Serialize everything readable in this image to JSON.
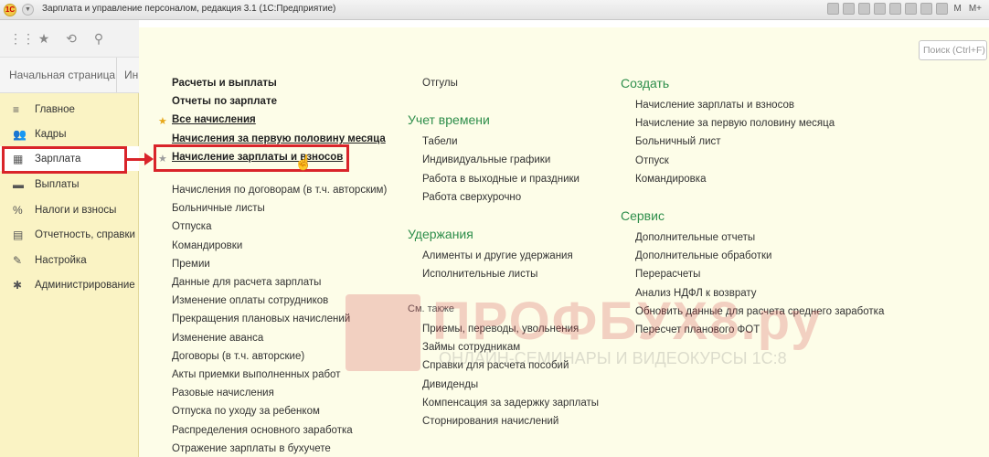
{
  "window": {
    "title": "Зарплата и управление персоналом, редакция 3.1  (1С:Предприятие)",
    "logo_text": "1С",
    "right_labels": [
      "M",
      "M+"
    ]
  },
  "tabs": {
    "home": "Начальная страница",
    "next_fragment": "Ин"
  },
  "sidebar": {
    "items": [
      {
        "label": "Главное",
        "icon": "list-icon",
        "glyph": "≡"
      },
      {
        "label": "Кадры",
        "icon": "people-icon",
        "glyph": "👥"
      },
      {
        "label": "Зарплата",
        "icon": "calculator-icon",
        "glyph": "▦"
      },
      {
        "label": "Выплаты",
        "icon": "payments-icon",
        "glyph": "▬"
      },
      {
        "label": "Налоги и взносы",
        "icon": "percent-icon",
        "glyph": "%"
      },
      {
        "label": "Отчетность, справки",
        "icon": "reports-icon",
        "glyph": "▤"
      },
      {
        "label": "Настройка",
        "icon": "wrench-icon",
        "glyph": "✎"
      },
      {
        "label": "Администрирование",
        "icon": "gear-icon",
        "glyph": "✱"
      }
    ],
    "active_index": 2
  },
  "search": {
    "placeholder": "Поиск (Ctrl+F)"
  },
  "col1": {
    "bold_links": [
      "Расчеты и выплаты",
      "Отчеты по зарплате",
      "Все начисления",
      "Начисления за первую половину месяца",
      "Начисление зарплаты и взносов"
    ],
    "links": [
      "Начисления по договорам (в т.ч. авторским)",
      "Больничные листы",
      "Отпуска",
      "Командировки",
      "Премии",
      "Данные для расчета зарплаты",
      "Изменение оплаты сотрудников",
      "Прекращения плановых начислений",
      "Изменение аванса",
      "Договоры (в т.ч. авторские)",
      "Акты приемки выполненных работ",
      "Разовые начисления",
      "Отпуска по уходу за ребенком",
      "Распределения основного заработка",
      "Отражение зарплаты в бухучете"
    ]
  },
  "col2": {
    "top_link": "Отгулы",
    "time_section": "Учет времени",
    "time_links": [
      "Табели",
      "Индивидуальные графики",
      "Работа в выходные и праздники",
      "Работа сверхурочно"
    ],
    "deductions_section": "Удержания",
    "deductions_links": [
      "Алименты и другие удержания",
      "Исполнительные листы"
    ],
    "see_also": "См. также",
    "see_also_links": [
      "Приемы, переводы, увольнения",
      "Займы сотрудникам",
      "Справки для расчета пособий",
      "Дивиденды",
      "Компенсация за задержку зарплаты",
      "Сторнирования начислений"
    ]
  },
  "col3": {
    "create_section": "Создать",
    "create_links": [
      "Начисление зарплаты и взносов",
      "Начисление за первую половину месяца",
      "Больничный лист",
      "Отпуск",
      "Командировка"
    ],
    "service_section": "Сервис",
    "service_links": [
      "Дополнительные отчеты",
      "Дополнительные обработки",
      "Перерасчеты",
      "Анализ НДФЛ к возврату",
      "Обновить данные для расчета среднего заработка",
      "Пересчет планового ФОТ"
    ]
  },
  "watermark": {
    "title": "ПРОФБУХ8.ру",
    "subtitle": "ОНЛАЙН-СЕМИНАРЫ И ВИДЕОКУРСЫ 1С:8"
  },
  "colors": {
    "section_green": "#2e8e4b",
    "sidebar_bg": "#faf3c4",
    "highlight_red": "#d9242a"
  }
}
